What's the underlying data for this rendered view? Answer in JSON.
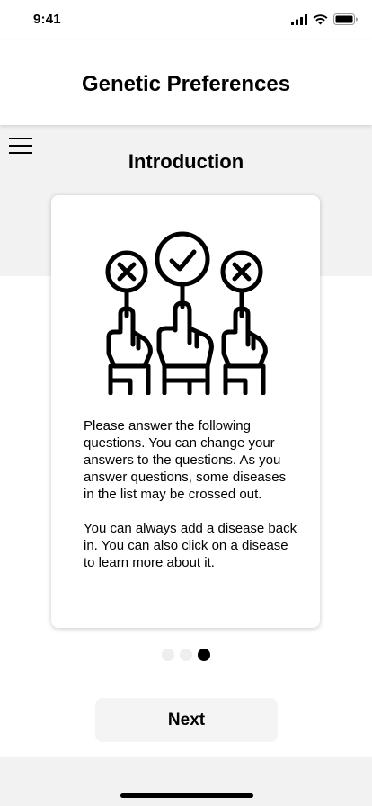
{
  "status_bar": {
    "time": "9:41",
    "icons": [
      "cellular-signal-icon",
      "wifi-icon",
      "battery-icon"
    ]
  },
  "header": {
    "title": "Genetic Preferences"
  },
  "menu": {
    "icon": "hamburger-menu-icon"
  },
  "section": {
    "title": "Introduction"
  },
  "card": {
    "illustration": "voting-hands-icon",
    "paragraphs": [
      "Please answer the following questions. You can change your answers to the questions. As you answer questions, some diseases in the list may be crossed out.",
      "You can always add a disease back in. You can also click on a disease to learn more about it."
    ]
  },
  "pagination": {
    "total": 3,
    "active_index": 2
  },
  "next_button": {
    "label": "Next"
  },
  "colors": {
    "background": "#ffffff",
    "band": "#f2f2f2",
    "button": "#f4f4f4",
    "text": "#000000",
    "dot_inactive": "#eeeeee",
    "dot_active": "#000000"
  }
}
